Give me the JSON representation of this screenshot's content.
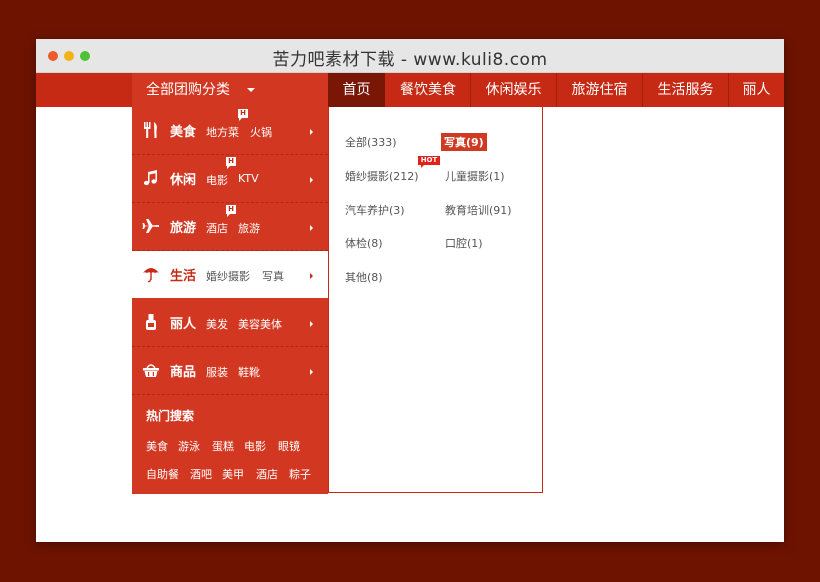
{
  "window": {
    "title": "苦力吧素材下载 - www.kuli8.com"
  },
  "category_header": {
    "label": "全部团购分类"
  },
  "nav": [
    {
      "label": "首页"
    },
    {
      "label": "餐饮美食"
    },
    {
      "label": "休闲娱乐"
    },
    {
      "label": "旅游住宿"
    },
    {
      "label": "生活服务"
    },
    {
      "label": "丽人"
    }
  ],
  "categories": [
    {
      "name": "美食",
      "icon": "fork-knife-icon",
      "subs": [
        "地方菜",
        "火锅"
      ],
      "badge": "H"
    },
    {
      "name": "休闲",
      "icon": "music-note-icon",
      "subs": [
        "电影",
        "KTV"
      ],
      "badge": "H"
    },
    {
      "name": "旅游",
      "icon": "airplane-icon",
      "subs": [
        "酒店",
        "旅游"
      ],
      "badge": "H"
    },
    {
      "name": "生活",
      "icon": "umbrella-icon",
      "subs": [
        "婚纱摄影",
        "写真"
      ]
    },
    {
      "name": "丽人",
      "icon": "nail-polish-icon",
      "subs": [
        "美发",
        "美容美体"
      ]
    },
    {
      "name": "商品",
      "icon": "shopping-basket-icon",
      "subs": [
        "服装",
        "鞋靴"
      ]
    }
  ],
  "hot_search": {
    "title": "热门搜索",
    "row1": [
      "美食",
      "游泳",
      "蛋糕",
      "电影",
      "眼镜"
    ],
    "row2": [
      "自助餐",
      "酒吧",
      "美甲",
      "酒店",
      "粽子"
    ]
  },
  "panel": {
    "items": [
      {
        "label": "全部(333)"
      },
      {
        "label": "写真(9)"
      },
      {
        "label": "婚纱摄影(212)"
      },
      {
        "label": "儿童摄影(1)"
      },
      {
        "label": "汽车养护(3)"
      },
      {
        "label": "教育培训(91)"
      },
      {
        "label": "体检(8)"
      },
      {
        "label": "口腔(1)"
      },
      {
        "label": "其他(8)"
      }
    ],
    "hot_badge": "HOT"
  },
  "colors": {
    "brand_red": "#c72a14",
    "dark_red": "#7a1606",
    "background": "#6e1300"
  }
}
